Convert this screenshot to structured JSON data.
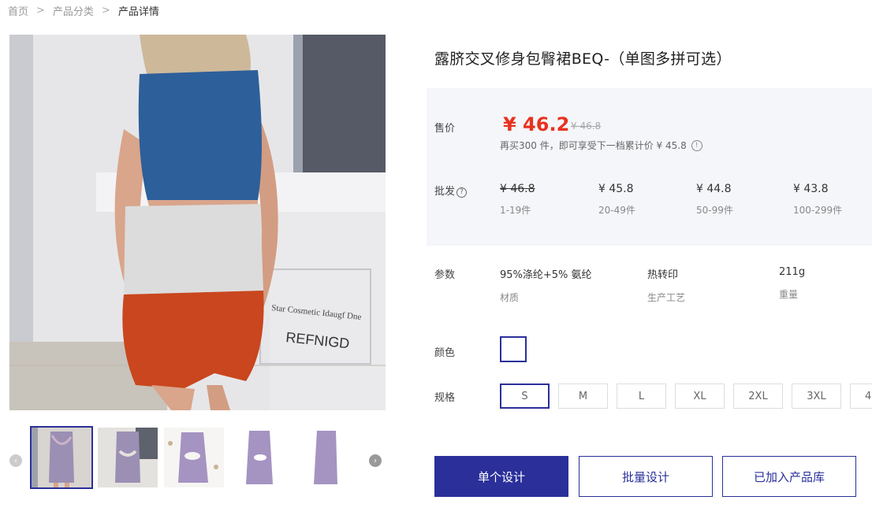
{
  "breadcrumb": {
    "home": "首页",
    "category": "产品分类",
    "current": "产品详情",
    "separator": ">"
  },
  "product": {
    "title": "露脐交叉修身包臀裙BEQ-（单图多拼可选）"
  },
  "photo": {
    "sign_line1": "Star Cosmetic Idaugf Dne",
    "sign_line2": "REFNIGD"
  },
  "pricing": {
    "label": "售价",
    "current": "¥ 46.2",
    "original": "¥ 46.8",
    "note": "再买300 件，即可享受下一档累计价 ¥ 45.8"
  },
  "wholesale": {
    "label": "批发",
    "tiers": [
      {
        "price": "¥ 46.8",
        "range": "1-19件"
      },
      {
        "price": "¥ 45.8",
        "range": "20-49件"
      },
      {
        "price": "¥ 44.8",
        "range": "50-99件"
      },
      {
        "price": "¥ 43.8",
        "range": "100-299件"
      }
    ]
  },
  "params": {
    "label": "参数",
    "items": [
      {
        "value": "95%涤纶+5% 氨纶",
        "key": "材质"
      },
      {
        "value": "热转印",
        "key": "生产工艺"
      },
      {
        "value": "211g",
        "key": "重量"
      }
    ]
  },
  "color": {
    "label": "颜色"
  },
  "sizes": {
    "label": "规格",
    "options": [
      "S",
      "M",
      "L",
      "XL",
      "2XL",
      "3XL",
      "4"
    ],
    "selected": "S"
  },
  "actions": {
    "single_design": "单个设计",
    "batch_design": "批量设计",
    "added_to_library": "已加入产品库"
  },
  "icons": {
    "thumb_prev": "chevron-left-icon",
    "thumb_next": "chevron-right-icon",
    "info": "info-icon",
    "question": "question-icon"
  },
  "colors": {
    "accent": "#2a2f9a",
    "price": "#e8321f",
    "panel": "#f4f6f9"
  }
}
